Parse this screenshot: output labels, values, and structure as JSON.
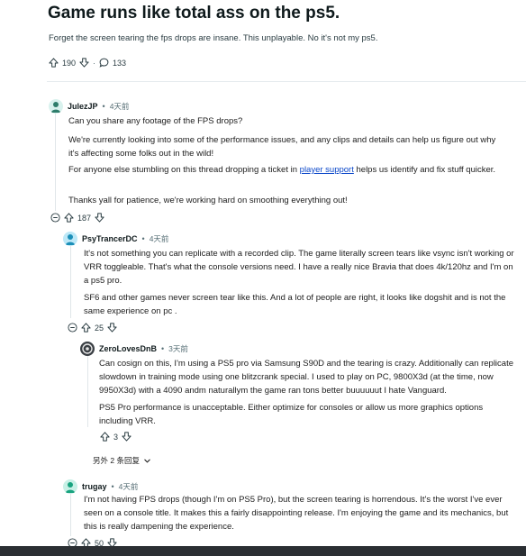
{
  "post": {
    "title": "Game runs like total ass on the ps5.",
    "body": "Forget the screen tearing the fps drops are insane. This unplayable. No it's not my ps5.",
    "upvotes": "190",
    "comments": "133"
  },
  "comments": [
    {
      "author": "JulezJP",
      "time": "4天前",
      "paragraphs": {
        "p1": "Can you share any footage of the FPS drops?",
        "p2": "We're currently looking into some of the performance issues, and any clips and details can help us figure out why it's affecting some folks out in the wild!",
        "p3_before": "For anyone else stumbling on this thread dropping a ticket in ",
        "p3_link": "player support",
        "p3_after": " helps us identify and fix stuff quicker.",
        "p4": "Thanks yall for patience, we're working hard on smoothing everything out!"
      },
      "votes": "187"
    },
    {
      "author": "PsyTrancerDC",
      "time": "4天前",
      "paragraphs": {
        "p1": "It's not something you can replicate with a recorded clip. The game literally screen tears like vsync isn't working or VRR toggleable. That's what the console versions need. I have a really nice Bravia that does 4k/120hz and I'm on a ps5 pro.",
        "p2": "SF6 and other games never screen tear like this. And a lot of people are right, it looks like dogshit and is not the same experience on pc ."
      },
      "votes": "25"
    },
    {
      "author": "ZeroLovesDnB",
      "time": "3天前",
      "paragraphs": {
        "p1": "Can cosign on this, I'm using a PS5 pro via Samsung S90D and the tearing is crazy. Additionally can replicate slowdown in training mode using one blitzcrank special. I used to play on PC, 9800X3d (at the time, now 9950X3d) with a 4090 andm naturallym the game ran tons better buuuuuut I hate Vanguard.",
        "p2": "PS5 Pro performance is unacceptable. Either optimize for consoles or allow us more graphics options including VRR."
      },
      "votes": "3"
    },
    {
      "author": "trugay",
      "time": "4天前",
      "paragraphs": {
        "p1": "I'm not having FPS drops (though I'm on PS5 Pro), but the screen tearing is horrendous. It's the worst I've ever seen on a console title. It makes this a fairly disappointing release. I'm enjoying the game and its mechanics, but this is really dampening the experience."
      },
      "votes": "50"
    }
  ],
  "more_replies": "另外 2 条回复",
  "colors": {
    "link": "#0a47c9",
    "meta": "#576f76",
    "thread_line": "#e0e6e9"
  }
}
